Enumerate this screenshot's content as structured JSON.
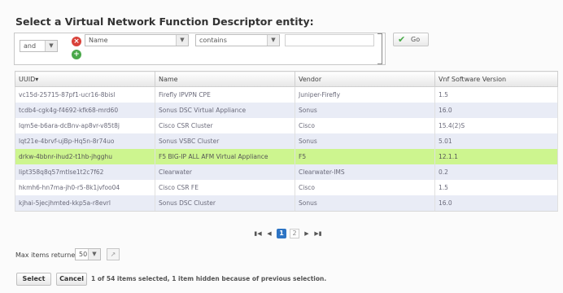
{
  "title": "Select a Virtual Network Function Descriptor entity:",
  "filter": {
    "logic": "and",
    "field": "Name",
    "operator": "contains",
    "value": "",
    "remove_icon": "remove-icon",
    "add_icon": "add-icon",
    "go_label": "Go",
    "go_icon": "check-icon"
  },
  "table": {
    "columns": [
      "UUID▾",
      "Name",
      "Vendor",
      "Vnf Software Version"
    ],
    "rows": [
      [
        "vc15d-25715-87pf1-ucr16-8bisl",
        "Firefly IPVPN CPE",
        "Juniper-Firefly",
        "1.5"
      ],
      [
        "tcdb4-cgk4g-f4692-kfk68-mrd60",
        "Sonus DSC Virtual Appliance",
        "Sonus",
        "16.0"
      ],
      [
        "lqm5e-b6ara-dcBnv-ap8vr-v85t8j",
        "Cisco CSR Cluster",
        "Cisco",
        "15.4(2)S"
      ],
      [
        "lqt21e-4brvf-ujBp-Hq5n-8r74uo",
        "Sonus VSBC Cluster",
        "Sonus",
        "5.01"
      ],
      [
        "drkw-4bbnr-ihud2-t1hb-jhgghu",
        "F5 BIG-IP ALL AFM Virtual Appliance",
        "F5",
        "12.1.1"
      ],
      [
        "lipt358q8q57mtlse1t2c7f62",
        "Clearwater",
        "Clearwater-IMS",
        "0.2"
      ],
      [
        "hkmh6-hn7ma-jh0-r5-8k1jvfoo04",
        "Cisco CSR FE",
        "Cisco",
        "1.5"
      ],
      [
        "kjhai-5jecjhmted-kkp5a-r8evrl",
        "Sonus DSC Cluster",
        "Sonus",
        "16.0"
      ]
    ],
    "selected_row": 4
  },
  "pager": {
    "first_icon": "first-page-icon",
    "prev_icon": "prev-page-icon",
    "current": "1",
    "next_page": "2",
    "next_icon": "next-page-icon",
    "last_icon": "last-page-icon"
  },
  "max_items": {
    "label": "Max items returned:",
    "value": "50",
    "export_icon": "export-icon"
  },
  "buttons": {
    "select": "Select",
    "cancel": "Cancel"
  },
  "status": "1 of 54 items selected, 1 item hidden because of previous selection."
}
